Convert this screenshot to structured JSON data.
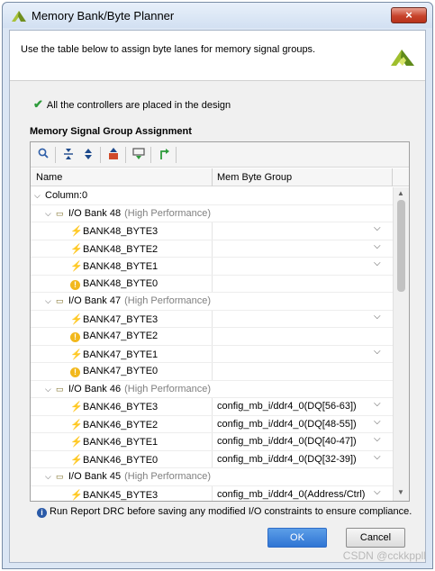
{
  "window": {
    "title": "Memory Bank/Byte Planner",
    "close_label": "×"
  },
  "header": {
    "description": "Use the table below to assign byte lanes for memory signal groups."
  },
  "status": {
    "icon": "checkmark-icon",
    "text": "All the controllers are placed in the design"
  },
  "section": {
    "title": "Memory Signal Group Assignment"
  },
  "toolbar": {
    "icons": [
      "search-icon",
      "collapse-all-icon",
      "expand-all-icon",
      "auto-assign-icon",
      "validate-icon",
      "placement-icon"
    ]
  },
  "table": {
    "columns": [
      "Name",
      "Mem Byte Group"
    ],
    "rows": [
      {
        "kind": "column",
        "name": "Column:0"
      },
      {
        "kind": "bank",
        "name": "I/O Bank 48",
        "perf": "(High Performance)"
      },
      {
        "kind": "byte",
        "name": "BANK48_BYTE3",
        "value": "",
        "dropdown": true
      },
      {
        "kind": "byte",
        "name": "BANK48_BYTE2",
        "value": "",
        "dropdown": true
      },
      {
        "kind": "byte",
        "name": "BANK48_BYTE1",
        "value": "",
        "dropdown": true
      },
      {
        "kind": "warn",
        "name": "BANK48_BYTE0",
        "value": "",
        "dropdown": false
      },
      {
        "kind": "bank",
        "name": "I/O Bank 47",
        "perf": "(High Performance)"
      },
      {
        "kind": "byte",
        "name": "BANK47_BYTE3",
        "value": "",
        "dropdown": true
      },
      {
        "kind": "warn",
        "name": "BANK47_BYTE2",
        "value": "",
        "dropdown": false
      },
      {
        "kind": "byte",
        "name": "BANK47_BYTE1",
        "value": "",
        "dropdown": true
      },
      {
        "kind": "warn",
        "name": "BANK47_BYTE0",
        "value": "",
        "dropdown": false
      },
      {
        "kind": "bank",
        "name": "I/O Bank 46",
        "perf": "(High Performance)"
      },
      {
        "kind": "byte",
        "name": "BANK46_BYTE3",
        "value": "config_mb_i/ddr4_0(DQ[56-63])",
        "dropdown": true
      },
      {
        "kind": "byte",
        "name": "BANK46_BYTE2",
        "value": "config_mb_i/ddr4_0(DQ[48-55])",
        "dropdown": true
      },
      {
        "kind": "byte",
        "name": "BANK46_BYTE1",
        "value": "config_mb_i/ddr4_0(DQ[40-47])",
        "dropdown": true
      },
      {
        "kind": "byte",
        "name": "BANK46_BYTE0",
        "value": "config_mb_i/ddr4_0(DQ[32-39])",
        "dropdown": true
      },
      {
        "kind": "bank",
        "name": "I/O Bank 45",
        "perf": "(High Performance)"
      },
      {
        "kind": "byte",
        "name": "BANK45_BYTE3",
        "value": "config_mb_i/ddr4_0(Address/Ctrl)",
        "dropdown": true
      }
    ]
  },
  "info": {
    "text": "Run Report DRC before saving any modified I/O constraints to ensure compliance."
  },
  "buttons": {
    "ok": "OK",
    "cancel": "Cancel"
  },
  "watermark": "CSDN @cckkppll",
  "colors": {
    "ok_button": "#2f75d4",
    "close_button": "#c7432b",
    "check": "#2e9b3b",
    "warning": "#f2b81c",
    "info": "#2a5aa8"
  }
}
